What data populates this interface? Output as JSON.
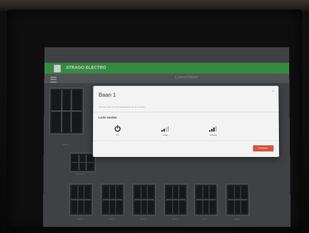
{
  "app": {
    "brand": "STRAGO ELECTRO",
    "title": "LumosTouch"
  },
  "lanes_top": [
    {
      "label": "Baan 1"
    },
    {
      "label": "Baan 2"
    }
  ],
  "lanes_bottom": [
    {
      "label": "Baan 3"
    },
    {
      "label": "Baan 4"
    },
    {
      "label": "Baan 5"
    },
    {
      "label": "Baan 6"
    },
    {
      "label": "Baan 7"
    },
    {
      "label": "Baan 8"
    }
  ],
  "extra_lane": {
    "label": "Buitenbaan"
  },
  "modal": {
    "title": "Baan 1",
    "close_symbol": "×",
    "subtitle": "Tap hieronder de verlichtingsstatus van dit veld aan.",
    "section_title": "Licht sterkte",
    "options": [
      {
        "label": "Uit",
        "icon": "power-icon"
      },
      {
        "label": "Laag",
        "icon": "signal-low-icon"
      },
      {
        "label": "Training",
        "icon": "signal-high-icon"
      }
    ],
    "close_button": "Annuleren"
  },
  "colors": {
    "brand_green": "#3fa34d",
    "button_red": "#d9533e"
  }
}
